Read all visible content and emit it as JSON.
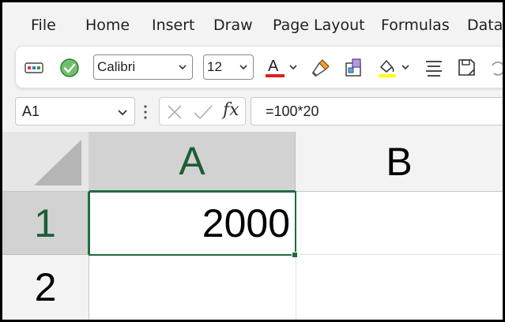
{
  "menu": {
    "items": [
      {
        "label": "File",
        "name": "menu-file"
      },
      {
        "label": "Home",
        "name": "menu-home"
      },
      {
        "label": "Insert",
        "name": "menu-insert"
      },
      {
        "label": "Draw",
        "name": "menu-draw"
      },
      {
        "label": "Page Layout",
        "name": "menu-page-layout"
      },
      {
        "label": "Formulas",
        "name": "menu-formulas"
      },
      {
        "label": "Data",
        "name": "menu-data"
      }
    ]
  },
  "toolbar": {
    "font_name": "Calibri",
    "font_size": "12",
    "font_color": "#e01e1e",
    "highlight_color": "#ffff00",
    "icons": [
      "cell-styles-icon",
      "accept-icon",
      "font-color-icon",
      "format-painter-icon",
      "styles-gallery-icon",
      "fill-color-icon",
      "align-icon",
      "save-format-icon"
    ]
  },
  "formula_bar": {
    "name_box": "A1",
    "formula": "=100*20",
    "fx_label": "fx"
  },
  "grid": {
    "columns": [
      "A",
      "B"
    ],
    "rows": [
      "1",
      "2"
    ],
    "cells": {
      "A1": "2000"
    },
    "selected_cell": "A1",
    "accent_color": "#217346"
  }
}
